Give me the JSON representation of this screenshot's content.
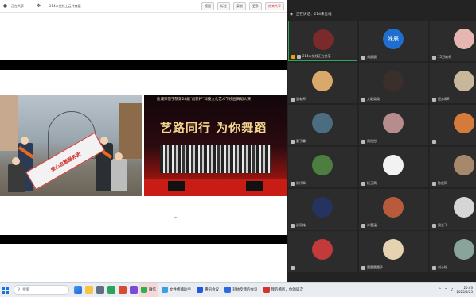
{
  "sharebar": {
    "status": "正在共享",
    "meeting": "214未觉线上云共商展",
    "view_label": "视图",
    "annotate_label": "标注",
    "more_label": "更多",
    "record_label": "录制",
    "stop_label": "结束共享"
  },
  "slide": {
    "photo1_banner": "爱心志愿服务团",
    "photo2_headline": "艺路同行 为你舞蹈",
    "photo2_subline": "盐城师范学院第24届\"创新杯\"科技文化艺术节校园舞蹈大赛"
  },
  "gallery": {
    "header_status": "正在讲话：214未觉线",
    "participants": [
      {
        "name": "214未觉线正在共享",
        "avatar_color": "#7a2a2a",
        "selected": true,
        "host": true
      },
      {
        "name": "刘辰辰",
        "avatar_text": "姝辰",
        "avatar_color": "#1f6fd1"
      },
      {
        "name": "15万教师",
        "avatar_color": "#e5b7b0"
      },
      {
        "name": "潘老师",
        "avatar_color": "#d9a86a"
      },
      {
        "name": "大彩局局",
        "avatar_color": "#3a2f2a"
      },
      {
        "name": "纪忠呢E",
        "avatar_color": "#c9b79c"
      },
      {
        "name": "晏子馨",
        "avatar_color": "#4a6d7f"
      },
      {
        "name": "周彤彤",
        "avatar_color": "#b78c8c"
      },
      {
        "name": "",
        "avatar_color": "#d47a3a"
      },
      {
        "name": "周伟翠",
        "avatar_color": "#4c7f3f"
      },
      {
        "name": "杨玉两",
        "avatar_color": "#f2f2f2"
      },
      {
        "name": "陈俊同",
        "avatar_color": "#a6896c"
      },
      {
        "name": "张琛炜",
        "avatar_color": "#26325f"
      },
      {
        "name": "许惠涵",
        "avatar_color": "#b85a3c"
      },
      {
        "name": "周兰飞",
        "avatar_color": "#d6d6d6"
      },
      {
        "name": "",
        "avatar_color": "#c43a3a"
      },
      {
        "name": "圆圆圆圆子",
        "avatar_color": "#e6d2b0"
      },
      {
        "name": "刘心怡",
        "avatar_color": "#8aa39b"
      }
    ]
  },
  "taskbar": {
    "search_placeholder": "搜索",
    "apps": [
      {
        "label": "微信",
        "color": "#2bb24c",
        "active": true
      },
      {
        "label": "文件传输助手",
        "color": "#39a0e6"
      },
      {
        "label": "腾讯会议",
        "color": "#1e5ad9"
      },
      {
        "label": "刘帅反馈的会议",
        "color": "#2a6be0"
      },
      {
        "label": "我的简历，你的届次",
        "color": "#d6312b"
      }
    ],
    "time": "20:03",
    "date": "2025/5/25"
  }
}
